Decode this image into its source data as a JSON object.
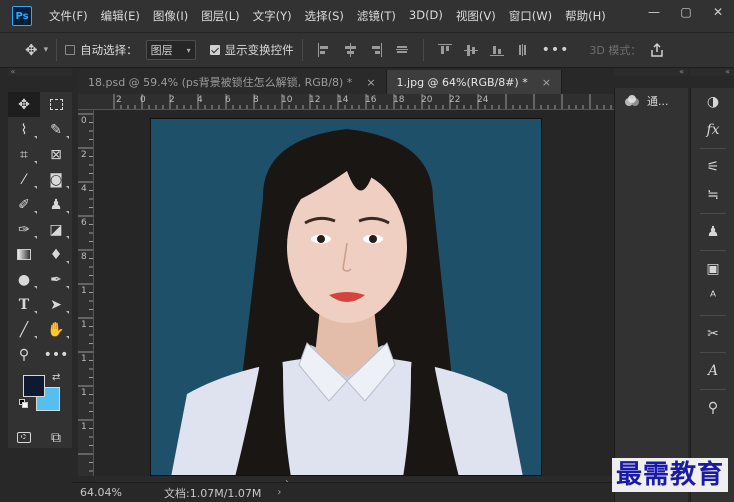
{
  "app": {
    "logo": "Ps"
  },
  "menu": [
    "文件(F)",
    "编辑(E)",
    "图像(I)",
    "图层(L)",
    "文字(Y)",
    "选择(S)",
    "滤镜(T)",
    "3D(D)",
    "视图(V)",
    "窗口(W)",
    "帮助(H)"
  ],
  "window_controls": {
    "minimize": "—",
    "maximize": "▢",
    "close": "✕"
  },
  "options": {
    "auto_select_label": "自动选择：",
    "auto_select_checked": false,
    "layer_select_value": "图层",
    "show_transform_label": "显示变换控件",
    "show_transform_checked": true,
    "more": "•••",
    "mode_3d": "3D 模式：",
    "share_icon": "share-icon"
  },
  "tabs": [
    {
      "label": "18.psd @ 59.4% (ps背景被锁住怎么解锁, RGB/8) *",
      "close": "×",
      "active": false
    },
    {
      "label": "1.jpg @ 64%(RGB/8#) *",
      "close": "×",
      "active": true
    }
  ],
  "ruler": {
    "top_ticks": [
      "2",
      "0",
      "2",
      "4",
      "6",
      "8",
      "10",
      "12",
      "14",
      "16",
      "18",
      "20",
      "22",
      "24"
    ],
    "left_ticks": [
      "0",
      "2",
      "4",
      "6",
      "8",
      "1",
      "1",
      "1",
      "1",
      "1"
    ]
  },
  "colors": {
    "foreground": "#0d1a2f",
    "background": "#55bff2",
    "photo_background": "#1e5069"
  },
  "status": {
    "zoom": "64.04%",
    "doc": "文档:1.07M/1.07M",
    "arrow": "›"
  },
  "scrollbar": {
    "chevron": "›"
  },
  "panels": {
    "channels_label": "通..."
  },
  "watermark": "最需教育"
}
